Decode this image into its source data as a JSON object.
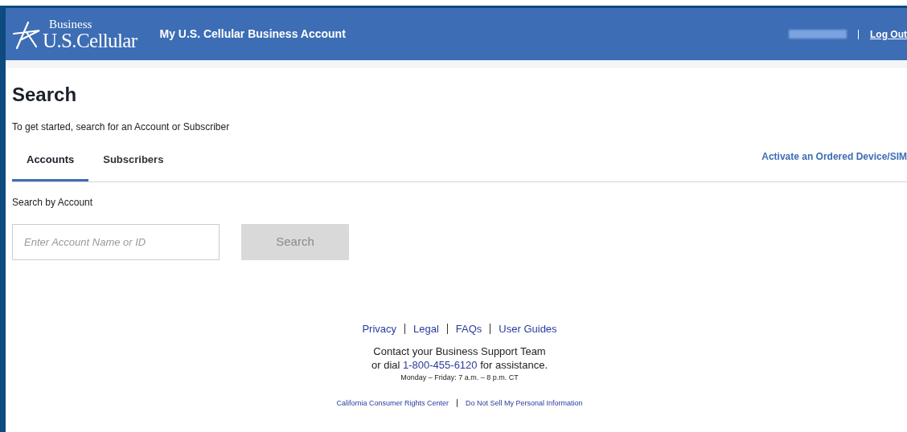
{
  "header": {
    "brand_small": "Business",
    "brand": "U.S.Cellular",
    "title": "My U.S. Cellular Business Account",
    "logout": "Log Out"
  },
  "page": {
    "heading": "Search",
    "intro": "To get started, search for an Account or Subscriber"
  },
  "tabs": [
    {
      "label": "Accounts",
      "selected": true
    },
    {
      "label": "Subscribers",
      "selected": false
    }
  ],
  "activate_link": "Activate an Ordered Device/SIM",
  "search": {
    "label": "Search by Account",
    "placeholder": "Enter Account Name or ID",
    "button": "Search",
    "disabled": true
  },
  "footer": {
    "links": [
      "Privacy",
      "Legal",
      "FAQs",
      "User Guides"
    ],
    "contact": {
      "line1": "Contact your Business Support Team",
      "before": "or dial",
      "phone": "1-800-455-6120",
      "after": "for assistance."
    },
    "hours": "Monday – Friday: 7 a.m. – 8 p.m. CT",
    "legal_links": [
      "California Consumer Rights Center",
      "Do Not Sell My Personal Information"
    ]
  }
}
